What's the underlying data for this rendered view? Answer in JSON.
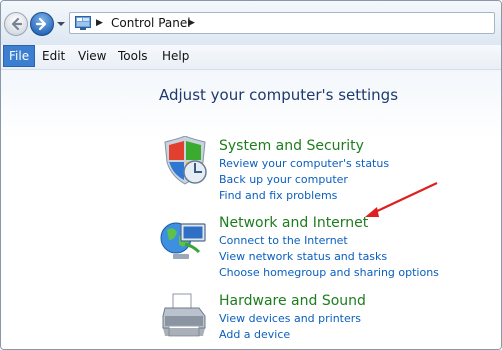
{
  "address_bar": {
    "breadcrumb": "Control Panel",
    "icons": {
      "back": "back-arrow-icon",
      "forward": "forward-arrow-icon",
      "folder": "control-panel-icon"
    }
  },
  "menu": {
    "items": [
      "File",
      "Edit",
      "View",
      "Tools",
      "Help"
    ],
    "active": "File"
  },
  "main": {
    "heading": "Adjust your computer's settings",
    "categories": [
      {
        "title": "System and Security",
        "icon": "shield-icon",
        "links": [
          "Review your computer's status",
          "Back up your computer",
          "Find and fix problems"
        ]
      },
      {
        "title": "Network and Internet",
        "icon": "network-globe-icon",
        "links": [
          "Connect to the Internet",
          "View network status and tasks",
          "Choose homegroup and sharing options"
        ]
      },
      {
        "title": "Hardware and Sound",
        "icon": "printer-icon",
        "links": [
          "View devices and printers",
          "Add a device"
        ]
      }
    ]
  },
  "annotation": {
    "arrow_color": "#e02020"
  },
  "colors": {
    "heading": "#1e3a6e",
    "category_title": "#1e7d1e",
    "link": "#0b5fbf"
  }
}
